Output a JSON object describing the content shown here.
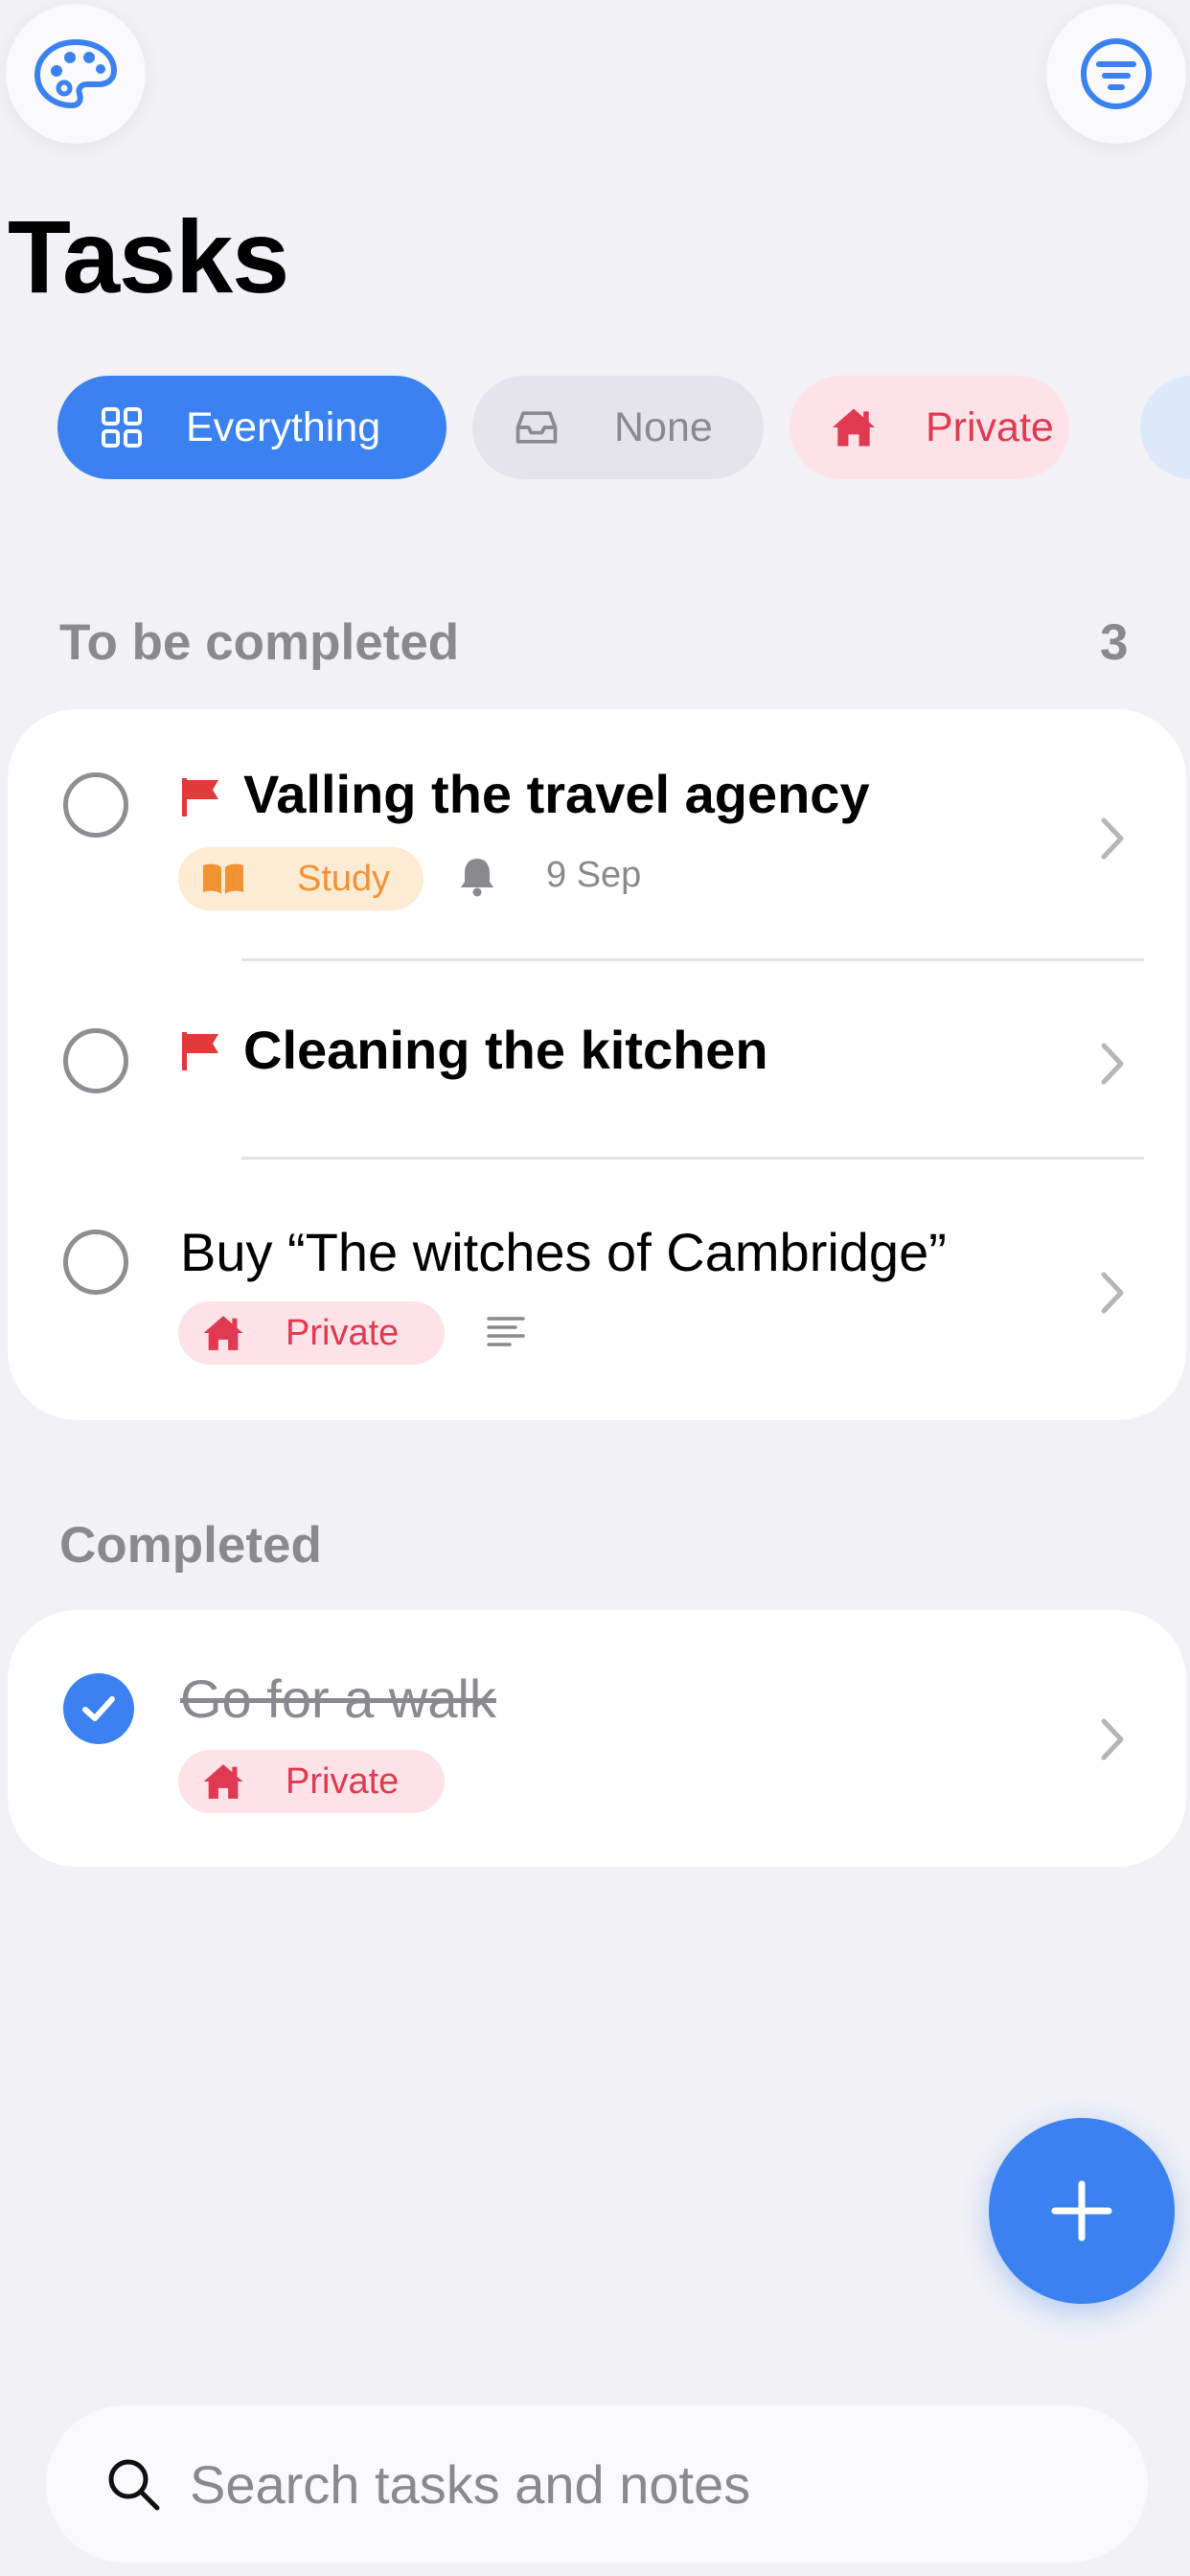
{
  "header": {
    "title": "Tasks",
    "left_icon": "palette-icon",
    "right_icon": "filter-lines-icon"
  },
  "filters": [
    {
      "label": "Everything",
      "icon": "grid-icon",
      "selected": true
    },
    {
      "label": "None",
      "icon": "inbox-tray-icon",
      "selected": false
    },
    {
      "label": "Private",
      "icon": "house-icon",
      "selected": false
    }
  ],
  "sections": {
    "todo": {
      "label": "To be completed",
      "count": "3",
      "tasks": [
        {
          "title": "Valling the travel agency",
          "flagged": true,
          "tag": "Study",
          "tag_icon": "book-icon",
          "reminder_icon": "bell-icon",
          "date": "9 Sep"
        },
        {
          "title": "Cleaning the kitchen",
          "flagged": true
        },
        {
          "title": "Buy “The witches of Cambridge”",
          "flagged": false,
          "tag": "Private",
          "tag_icon": "house-icon",
          "note_icon": "notes-lines-icon"
        }
      ]
    },
    "done": {
      "label": "Completed",
      "tasks": [
        {
          "title": "Go for a walk",
          "completed": true,
          "tag": "Private",
          "tag_icon": "house-icon"
        }
      ]
    }
  },
  "search": {
    "placeholder": "Search tasks and notes",
    "icon": "search-icon"
  },
  "colors": {
    "accent": "#3b82f0",
    "private": "#e03a52",
    "study": "#f29233",
    "background": "#f1f1f6"
  }
}
